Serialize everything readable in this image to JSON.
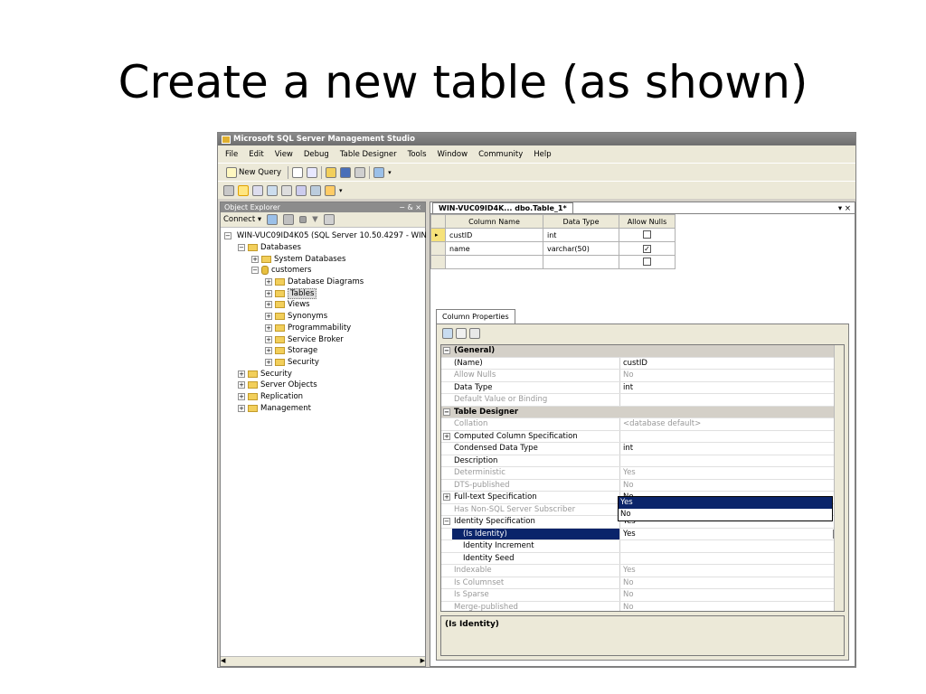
{
  "slide": {
    "title": "Create a new table (as shown)"
  },
  "app": {
    "title": "Microsoft SQL Server Management Studio",
    "menu": [
      "File",
      "Edit",
      "View",
      "Debug",
      "Table Designer",
      "Tools",
      "Window",
      "Community",
      "Help"
    ],
    "toolbar": {
      "new_query_label": "New Query"
    }
  },
  "object_explorer": {
    "title": "Object Explorer",
    "pin": "− & ×",
    "connect_label": "Connect ▾",
    "tree": [
      {
        "label": "WIN-VUC09ID4K05 (SQL Server 10.50.4297 - WIN",
        "indent": 0,
        "icon": "server",
        "exp": "−"
      },
      {
        "label": "Databases",
        "indent": 1,
        "icon": "folder",
        "exp": "−"
      },
      {
        "label": "System Databases",
        "indent": 2,
        "icon": "folder",
        "exp": "+"
      },
      {
        "label": "customers",
        "indent": 2,
        "icon": "db",
        "exp": "−"
      },
      {
        "label": "Database Diagrams",
        "indent": 3,
        "icon": "folder",
        "exp": "+"
      },
      {
        "label": "Tables",
        "indent": 3,
        "icon": "folder",
        "exp": "+",
        "selected": true
      },
      {
        "label": "Views",
        "indent": 3,
        "icon": "folder",
        "exp": "+"
      },
      {
        "label": "Synonyms",
        "indent": 3,
        "icon": "folder",
        "exp": "+"
      },
      {
        "label": "Programmability",
        "indent": 3,
        "icon": "folder",
        "exp": "+"
      },
      {
        "label": "Service Broker",
        "indent": 3,
        "icon": "folder",
        "exp": "+"
      },
      {
        "label": "Storage",
        "indent": 3,
        "icon": "folder",
        "exp": "+"
      },
      {
        "label": "Security",
        "indent": 3,
        "icon": "folder",
        "exp": "+"
      },
      {
        "label": "Security",
        "indent": 1,
        "icon": "folder",
        "exp": "+"
      },
      {
        "label": "Server Objects",
        "indent": 1,
        "icon": "folder",
        "exp": "+"
      },
      {
        "label": "Replication",
        "indent": 1,
        "icon": "folder",
        "exp": "+"
      },
      {
        "label": "Management",
        "indent": 1,
        "icon": "folder",
        "exp": "+"
      }
    ]
  },
  "designer": {
    "tab_label": "WIN-VUC09ID4K... dbo.Table_1*",
    "close": "▾ ×",
    "headers": [
      "Column Name",
      "Data Type",
      "Allow Nulls"
    ],
    "rows": [
      {
        "name": "custID",
        "type": "int",
        "nulls": false,
        "key": true
      },
      {
        "name": "name",
        "type": "varchar(50)",
        "nulls": true,
        "key": false
      },
      {
        "name": "",
        "type": "",
        "nulls": false,
        "key": false
      }
    ]
  },
  "column_properties": {
    "tab_label": "Column Properties",
    "rows": [
      {
        "kind": "cat",
        "exp": "−",
        "name": "(General)"
      },
      {
        "kind": "prop",
        "name": "(Name)",
        "value": "custID",
        "dim": false
      },
      {
        "kind": "prop",
        "name": "Allow Nulls",
        "value": "No",
        "dim": true
      },
      {
        "kind": "prop",
        "name": "Data Type",
        "value": "int",
        "dim": false
      },
      {
        "kind": "prop",
        "name": "Default Value or Binding",
        "value": "",
        "dim": true
      },
      {
        "kind": "cat",
        "exp": "−",
        "name": "Table Designer"
      },
      {
        "kind": "prop",
        "name": "Collation",
        "value": "<database default>",
        "dim": true
      },
      {
        "kind": "prop",
        "exp": "+",
        "name": "Computed Column Specification",
        "value": "",
        "dim": false
      },
      {
        "kind": "prop",
        "name": "Condensed Data Type",
        "value": "int",
        "dim": false
      },
      {
        "kind": "prop",
        "name": "Description",
        "value": "",
        "dim": false
      },
      {
        "kind": "prop",
        "name": "Deterministic",
        "value": "Yes",
        "dim": true
      },
      {
        "kind": "prop",
        "name": "DTS-published",
        "value": "No",
        "dim": true
      },
      {
        "kind": "prop",
        "exp": "+",
        "name": "Full-text Specification",
        "value": "No",
        "dim": false
      },
      {
        "kind": "prop",
        "name": "Has Non-SQL Server Subscriber",
        "value": "No",
        "dim": true
      },
      {
        "kind": "prop",
        "exp": "−",
        "name": "Identity Specification",
        "value": "Yes",
        "dim": false
      },
      {
        "kind": "sub",
        "name": "(Is Identity)",
        "value": "Yes",
        "selected": true
      },
      {
        "kind": "sub",
        "name": "Identity Increment",
        "value": "",
        "dim": false
      },
      {
        "kind": "sub",
        "name": "Identity Seed",
        "value": "",
        "dim": false
      },
      {
        "kind": "prop",
        "name": "Indexable",
        "value": "Yes",
        "dim": true
      },
      {
        "kind": "prop",
        "name": "Is Columnset",
        "value": "No",
        "dim": true
      },
      {
        "kind": "prop",
        "name": "Is Sparse",
        "value": "No",
        "dim": true
      },
      {
        "kind": "prop",
        "name": "Merge-published",
        "value": "No",
        "dim": true
      }
    ],
    "dropdown_options": [
      "Yes",
      "No"
    ],
    "description_title": "(Is Identity)"
  }
}
